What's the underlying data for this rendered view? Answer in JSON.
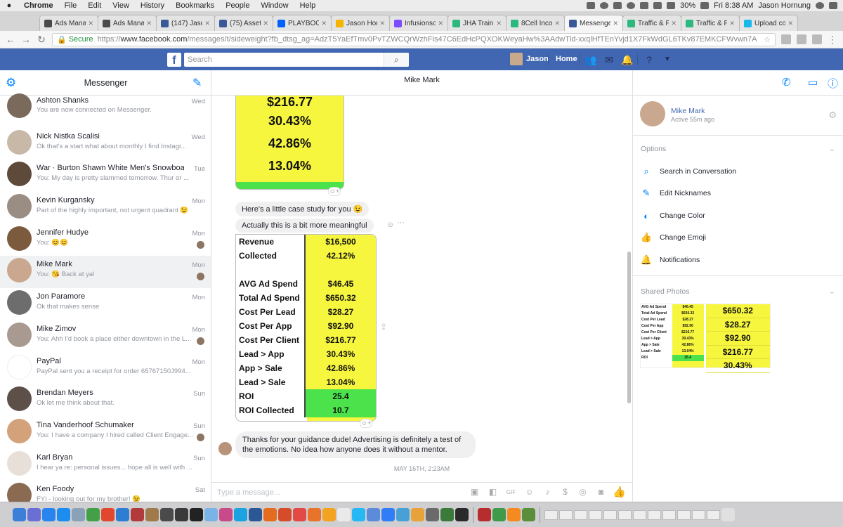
{
  "menubar": {
    "app": "Chrome",
    "menus": [
      "File",
      "Edit",
      "View",
      "History",
      "Bookmarks",
      "People",
      "Window",
      "Help"
    ],
    "battery": "30%",
    "clock": "Fri 8:38 AM",
    "user": "Jason Hornung"
  },
  "tabs": [
    {
      "label": "Ads Manag",
      "color": "#4a4a4a"
    },
    {
      "label": "Ads Manag",
      "color": "#4a4a4a"
    },
    {
      "label": "(147) Jason",
      "color": "#3b5998"
    },
    {
      "label": "(75) Asset",
      "color": "#3b5998"
    },
    {
      "label": "PLAYBOOK",
      "color": "#0061fe"
    },
    {
      "label": "Jason Horn",
      "color": "#f4b400"
    },
    {
      "label": "Infusionsof",
      "color": "#7c4dff"
    },
    {
      "label": "JHA Trainin",
      "color": "#2db87d"
    },
    {
      "label": "8Cell Incon",
      "color": "#2db87d"
    },
    {
      "label": "Messenger",
      "color": "#3b5998",
      "active": true
    },
    {
      "label": "Traffic & Fu",
      "color": "#2db87d"
    },
    {
      "label": "Traffic & Fu",
      "color": "#2db87d"
    },
    {
      "label": "Upload con",
      "color": "#1ab7ea"
    }
  ],
  "address": {
    "secure_label": "Secure",
    "url_prefix": "https://",
    "url_host": "www.facebook.com",
    "url_path": "/messages/t/sideweight?fb_dtsg_ag=AdzT5YaEfTmv0PvTZWCQrWzhFis47C6EdHcPQXOKWeyaHw%3AAdwTld-xxqlHfTEnYvjd1X7FkWdGL6TKv87EMKCFWvwn7A"
  },
  "fb": {
    "logo": "f",
    "search_placeholder": "Search",
    "user": "Jason",
    "home": "Home"
  },
  "left": {
    "title": "Messenger",
    "conversations": [
      {
        "name": "Ashton Shanks",
        "preview": "You are now connected on Messenger.",
        "date": "Wed",
        "avatar": "#7a6a5c"
      },
      {
        "name": "Nick Nistka Scalisi",
        "preview": "Ok that's a start what about monthly I find Instagr...",
        "date": "Wed",
        "avatar": "#c8b8a8"
      },
      {
        "name": "War · Burton Shawn White Men's Snowboar...",
        "preview": "You: My day is pretty slammed tomorrow. Thur or ...",
        "date": "Tue",
        "avatar": "#5d4a3a"
      },
      {
        "name": "Kevin Kurgansky",
        "preview": "Part of the highly important, not urgent quadrant 😉",
        "date": "Mon",
        "avatar": "#9a8d84"
      },
      {
        "name": "Jennifer Hudye",
        "preview": "You: 😊😊",
        "date": "Mon",
        "avatar": "#7b5a3d",
        "seen": true
      },
      {
        "name": "Mike Mark",
        "preview": "You: 😘 Back at ya!",
        "date": "Mon",
        "avatar": "#c9a88f",
        "seen": true,
        "selected": true
      },
      {
        "name": "Jon Paramore",
        "preview": "Ok that makes sense",
        "date": "Mon",
        "avatar": "#6d6d6d"
      },
      {
        "name": "Mike Zimov",
        "preview": "You: Ahh I'd book a place either downtown in the L...",
        "date": "Mon",
        "avatar": "#a89a90",
        "seen": true
      },
      {
        "name": "PayPal",
        "preview": "PayPal sent you a receipt for order 65767150J994...",
        "date": "Mon",
        "avatar": "#ffffff"
      },
      {
        "name": "Brendan Meyers",
        "preview": "Ok let me think about that.",
        "date": "Sun",
        "avatar": "#5c5048"
      },
      {
        "name": "Tina Vanderhoof Schumaker",
        "preview": "You: I have a company I hired called Client Engage...",
        "date": "Sun",
        "avatar": "#d4a27a",
        "seen": true
      },
      {
        "name": "Karl Bryan",
        "preview": "I hear ya re: personal issues... hope all is well with ...",
        "date": "Sun",
        "avatar": "#e8e0d8"
      },
      {
        "name": "Ken Foody",
        "preview": "FYI - looking out for my brother! 😉",
        "date": "Sat",
        "avatar": "#8a6b52"
      }
    ]
  },
  "chat": {
    "title": "Mike Mark",
    "image1_values": [
      "$216.77",
      "30.43%",
      "42.86%",
      "13.04%"
    ],
    "message1": "Here's a little case study for you 😉",
    "message2": "Actually this is a bit more meaningful",
    "sheet_rows": [
      {
        "label": "Revenue",
        "value": "$16,500"
      },
      {
        "label": "Collected",
        "value": "42.12%"
      },
      {
        "label": "",
        "value": ""
      },
      {
        "label": "AVG Ad Spend",
        "value": "$46.45"
      },
      {
        "label": "Total Ad Spend",
        "value": "$650.32"
      },
      {
        "label": "Cost Per Lead",
        "value": "$28.27"
      },
      {
        "label": "Cost Per App",
        "value": "$92.90"
      },
      {
        "label": "Cost Per Client",
        "value": "$216.77"
      },
      {
        "label": "Lead > App",
        "value": "30.43%"
      },
      {
        "label": "App > Sale",
        "value": "42.86%"
      },
      {
        "label": "Lead > Sale",
        "value": "13.04%"
      },
      {
        "label": "ROI",
        "value": "25.4",
        "green": true
      },
      {
        "label": "ROI Collected",
        "value": "10.7",
        "green": true
      }
    ],
    "reply": "Thanks for your guidance dude! Advertising is definitely a test of the emotions. No idea how anyone does it without a mentor.",
    "datestamp": "MAY 16TH, 2:23AM",
    "composer_placeholder": "Type a message...",
    "accent": "#0084ff"
  },
  "right": {
    "name": "Mike Mark",
    "status": "Active 55m ago",
    "options_header": "Options",
    "options": [
      {
        "label": "Search in Conversation",
        "icon": "search-icon"
      },
      {
        "label": "Edit Nicknames",
        "icon": "pencil-icon"
      },
      {
        "label": "Change Color",
        "icon": "palette-icon"
      },
      {
        "label": "Change Emoji",
        "icon": "thumbs-up-icon"
      },
      {
        "label": "Notifications",
        "icon": "bell-icon"
      }
    ],
    "shared_header": "Shared Photos",
    "thumb_labels": [
      "AVG Ad Spend",
      "Total Ad Spend",
      "Cost Per Lead",
      "Cost Per App",
      "Cost Per Client",
      "Lead > App",
      "App > Sale",
      "Lead > Sale",
      "ROI"
    ],
    "thumb_values": [
      "$46.45",
      "$650.32",
      "$28.27",
      "$92.90",
      "$216.77",
      "30.43%",
      "42.86%",
      "13.04%",
      "25.4"
    ],
    "thumb_big": [
      "$650.32",
      "$28.27",
      "$92.90",
      "$216.77",
      "30.43%"
    ]
  },
  "dock": {
    "icons": [
      "#3b7fd9",
      "#6a6fd6",
      "#2a84f0",
      "#1c8cf0",
      "#8aa2b8",
      "#44a046",
      "#e1472f",
      "#2d7dd2",
      "#b23a3a",
      "#a07a4a",
      "#4a4a4a",
      "#3a3a3a",
      "#222222",
      "#7ab3e6",
      "#c84a8a",
      "#1aa3e0",
      "#2b5797",
      "#e36c1e",
      "#d64b2a",
      "#e24a45",
      "#e8742c",
      "#f3a321",
      "#eaeaea",
      "#26b7f5",
      "#5b8bd9",
      "#2f7df7",
      "#48a0d7",
      "#e7a23a",
      "#6a6a6a",
      "#3b7a3a",
      "#2a2a2a",
      "#b72c2c",
      "#3f9a4a",
      "#f58a20",
      "#5b8e3a"
    ]
  }
}
